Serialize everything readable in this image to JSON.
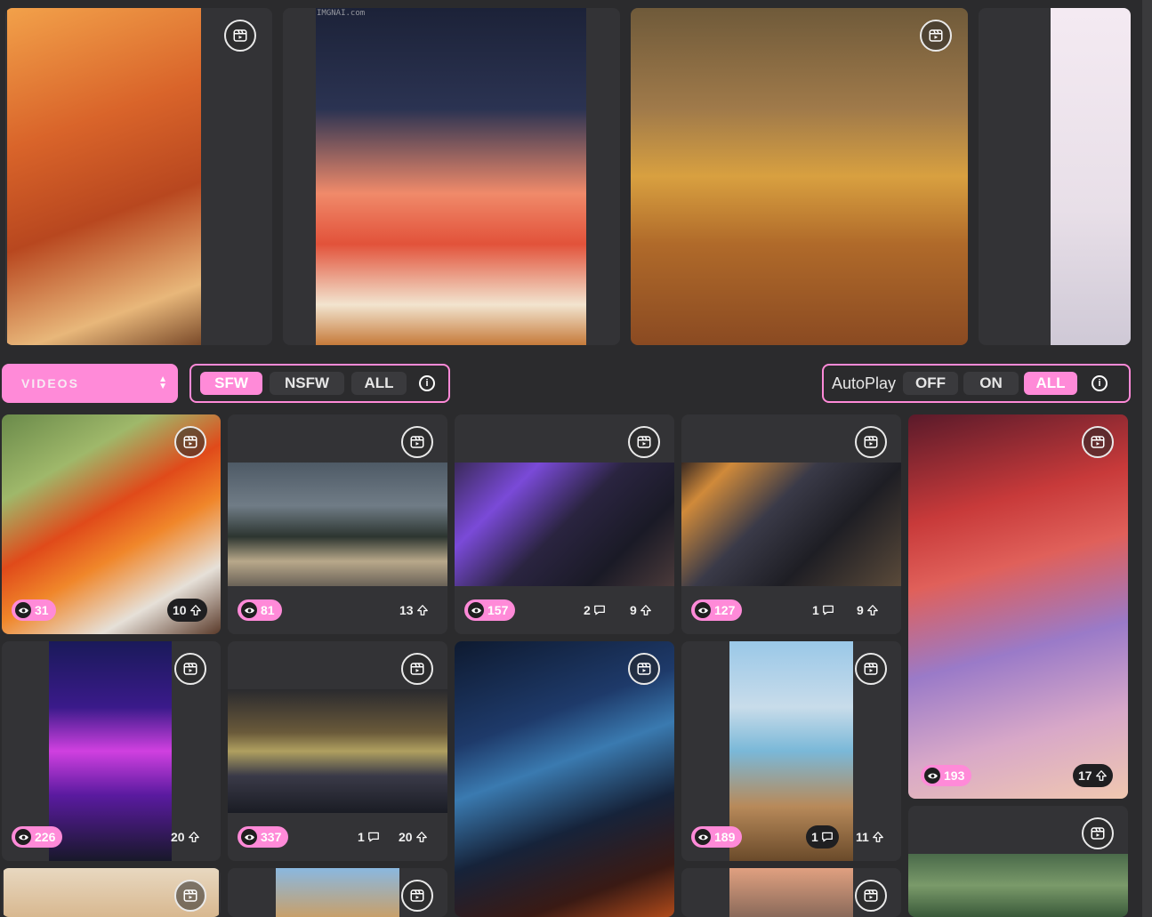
{
  "type_select": {
    "value": "VIDEOS"
  },
  "content_filter": {
    "options": [
      "SFW",
      "NSFW",
      "ALL"
    ],
    "selected": "SFW",
    "info": "i"
  },
  "autoplay": {
    "label": "AutoPlay",
    "options": [
      "OFF",
      "ON",
      "ALL"
    ],
    "selected": "ALL",
    "info": "i"
  },
  "watermark": "IMGNAI.com",
  "accent_color": "#ff8ad8",
  "items": [
    {
      "views": "31",
      "likes": "10"
    },
    {
      "views": "81",
      "likes": "13"
    },
    {
      "views": "157",
      "comments": "2",
      "likes": "9"
    },
    {
      "views": "127",
      "comments": "1",
      "likes": "9"
    },
    {
      "views": "193",
      "likes": "17"
    },
    {
      "views": "226",
      "likes": "20"
    },
    {
      "views": "337",
      "comments": "1",
      "likes": "20"
    },
    {
      "views": "189",
      "comments": "1",
      "likes": "11"
    }
  ]
}
